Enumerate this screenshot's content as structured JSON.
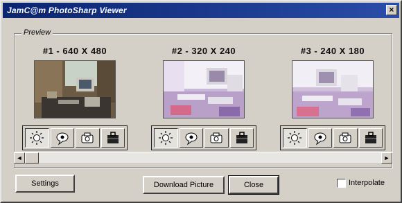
{
  "window": {
    "title": "JamC@m PhotoSharp Viewer",
    "close_glyph": "×"
  },
  "group": {
    "label": "Preview"
  },
  "previews": [
    {
      "label": "#1 - 640 X 480",
      "image": "photo-office-dark"
    },
    {
      "label": "#2 - 320 X 240",
      "image": "photo-office-bright"
    },
    {
      "label": "#3 - 240 X 180",
      "image": "photo-office-bright"
    }
  ],
  "toolbar_icons": [
    "sun-icon",
    "speech-bubble-icon",
    "camera-icon",
    "briefcase-icon"
  ],
  "scrollbar": {
    "left_arrow": "◄",
    "right_arrow": "►"
  },
  "buttons": {
    "settings": "Settings",
    "download": "Download Picture",
    "close": "Close"
  },
  "interpolate": {
    "label": "Interpolate",
    "checked": false
  }
}
